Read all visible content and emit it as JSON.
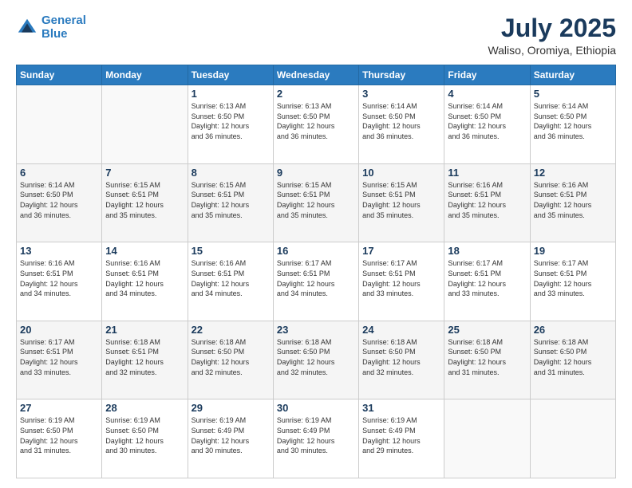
{
  "logo": {
    "line1": "General",
    "line2": "Blue"
  },
  "title": "July 2025",
  "location": "Waliso, Oromiya, Ethiopia",
  "days_header": [
    "Sunday",
    "Monday",
    "Tuesday",
    "Wednesday",
    "Thursday",
    "Friday",
    "Saturday"
  ],
  "weeks": [
    [
      {
        "day": "",
        "info": ""
      },
      {
        "day": "",
        "info": ""
      },
      {
        "day": "1",
        "sunrise": "6:13 AM",
        "sunset": "6:50 PM",
        "daylight": "12 hours and 36 minutes."
      },
      {
        "day": "2",
        "sunrise": "6:13 AM",
        "sunset": "6:50 PM",
        "daylight": "12 hours and 36 minutes."
      },
      {
        "day": "3",
        "sunrise": "6:14 AM",
        "sunset": "6:50 PM",
        "daylight": "12 hours and 36 minutes."
      },
      {
        "day": "4",
        "sunrise": "6:14 AM",
        "sunset": "6:50 PM",
        "daylight": "12 hours and 36 minutes."
      },
      {
        "day": "5",
        "sunrise": "6:14 AM",
        "sunset": "6:50 PM",
        "daylight": "12 hours and 36 minutes."
      }
    ],
    [
      {
        "day": "6",
        "sunrise": "6:14 AM",
        "sunset": "6:50 PM",
        "daylight": "12 hours and 36 minutes."
      },
      {
        "day": "7",
        "sunrise": "6:15 AM",
        "sunset": "6:51 PM",
        "daylight": "12 hours and 35 minutes."
      },
      {
        "day": "8",
        "sunrise": "6:15 AM",
        "sunset": "6:51 PM",
        "daylight": "12 hours and 35 minutes."
      },
      {
        "day": "9",
        "sunrise": "6:15 AM",
        "sunset": "6:51 PM",
        "daylight": "12 hours and 35 minutes."
      },
      {
        "day": "10",
        "sunrise": "6:15 AM",
        "sunset": "6:51 PM",
        "daylight": "12 hours and 35 minutes."
      },
      {
        "day": "11",
        "sunrise": "6:16 AM",
        "sunset": "6:51 PM",
        "daylight": "12 hours and 35 minutes."
      },
      {
        "day": "12",
        "sunrise": "6:16 AM",
        "sunset": "6:51 PM",
        "daylight": "12 hours and 35 minutes."
      }
    ],
    [
      {
        "day": "13",
        "sunrise": "6:16 AM",
        "sunset": "6:51 PM",
        "daylight": "12 hours and 34 minutes."
      },
      {
        "day": "14",
        "sunrise": "6:16 AM",
        "sunset": "6:51 PM",
        "daylight": "12 hours and 34 minutes."
      },
      {
        "day": "15",
        "sunrise": "6:16 AM",
        "sunset": "6:51 PM",
        "daylight": "12 hours and 34 minutes."
      },
      {
        "day": "16",
        "sunrise": "6:17 AM",
        "sunset": "6:51 PM",
        "daylight": "12 hours and 34 minutes."
      },
      {
        "day": "17",
        "sunrise": "6:17 AM",
        "sunset": "6:51 PM",
        "daylight": "12 hours and 33 minutes."
      },
      {
        "day": "18",
        "sunrise": "6:17 AM",
        "sunset": "6:51 PM",
        "daylight": "12 hours and 33 minutes."
      },
      {
        "day": "19",
        "sunrise": "6:17 AM",
        "sunset": "6:51 PM",
        "daylight": "12 hours and 33 minutes."
      }
    ],
    [
      {
        "day": "20",
        "sunrise": "6:17 AM",
        "sunset": "6:51 PM",
        "daylight": "12 hours and 33 minutes."
      },
      {
        "day": "21",
        "sunrise": "6:18 AM",
        "sunset": "6:51 PM",
        "daylight": "12 hours and 32 minutes."
      },
      {
        "day": "22",
        "sunrise": "6:18 AM",
        "sunset": "6:50 PM",
        "daylight": "12 hours and 32 minutes."
      },
      {
        "day": "23",
        "sunrise": "6:18 AM",
        "sunset": "6:50 PM",
        "daylight": "12 hours and 32 minutes."
      },
      {
        "day": "24",
        "sunrise": "6:18 AM",
        "sunset": "6:50 PM",
        "daylight": "12 hours and 32 minutes."
      },
      {
        "day": "25",
        "sunrise": "6:18 AM",
        "sunset": "6:50 PM",
        "daylight": "12 hours and 31 minutes."
      },
      {
        "day": "26",
        "sunrise": "6:18 AM",
        "sunset": "6:50 PM",
        "daylight": "12 hours and 31 minutes."
      }
    ],
    [
      {
        "day": "27",
        "sunrise": "6:19 AM",
        "sunset": "6:50 PM",
        "daylight": "12 hours and 31 minutes."
      },
      {
        "day": "28",
        "sunrise": "6:19 AM",
        "sunset": "6:50 PM",
        "daylight": "12 hours and 30 minutes."
      },
      {
        "day": "29",
        "sunrise": "6:19 AM",
        "sunset": "6:49 PM",
        "daylight": "12 hours and 30 minutes."
      },
      {
        "day": "30",
        "sunrise": "6:19 AM",
        "sunset": "6:49 PM",
        "daylight": "12 hours and 30 minutes."
      },
      {
        "day": "31",
        "sunrise": "6:19 AM",
        "sunset": "6:49 PM",
        "daylight": "12 hours and 29 minutes."
      },
      {
        "day": "",
        "info": ""
      },
      {
        "day": "",
        "info": ""
      }
    ]
  ],
  "labels": {
    "sunrise_prefix": "Sunrise: ",
    "sunset_prefix": "Sunset: ",
    "daylight_prefix": "Daylight: "
  }
}
